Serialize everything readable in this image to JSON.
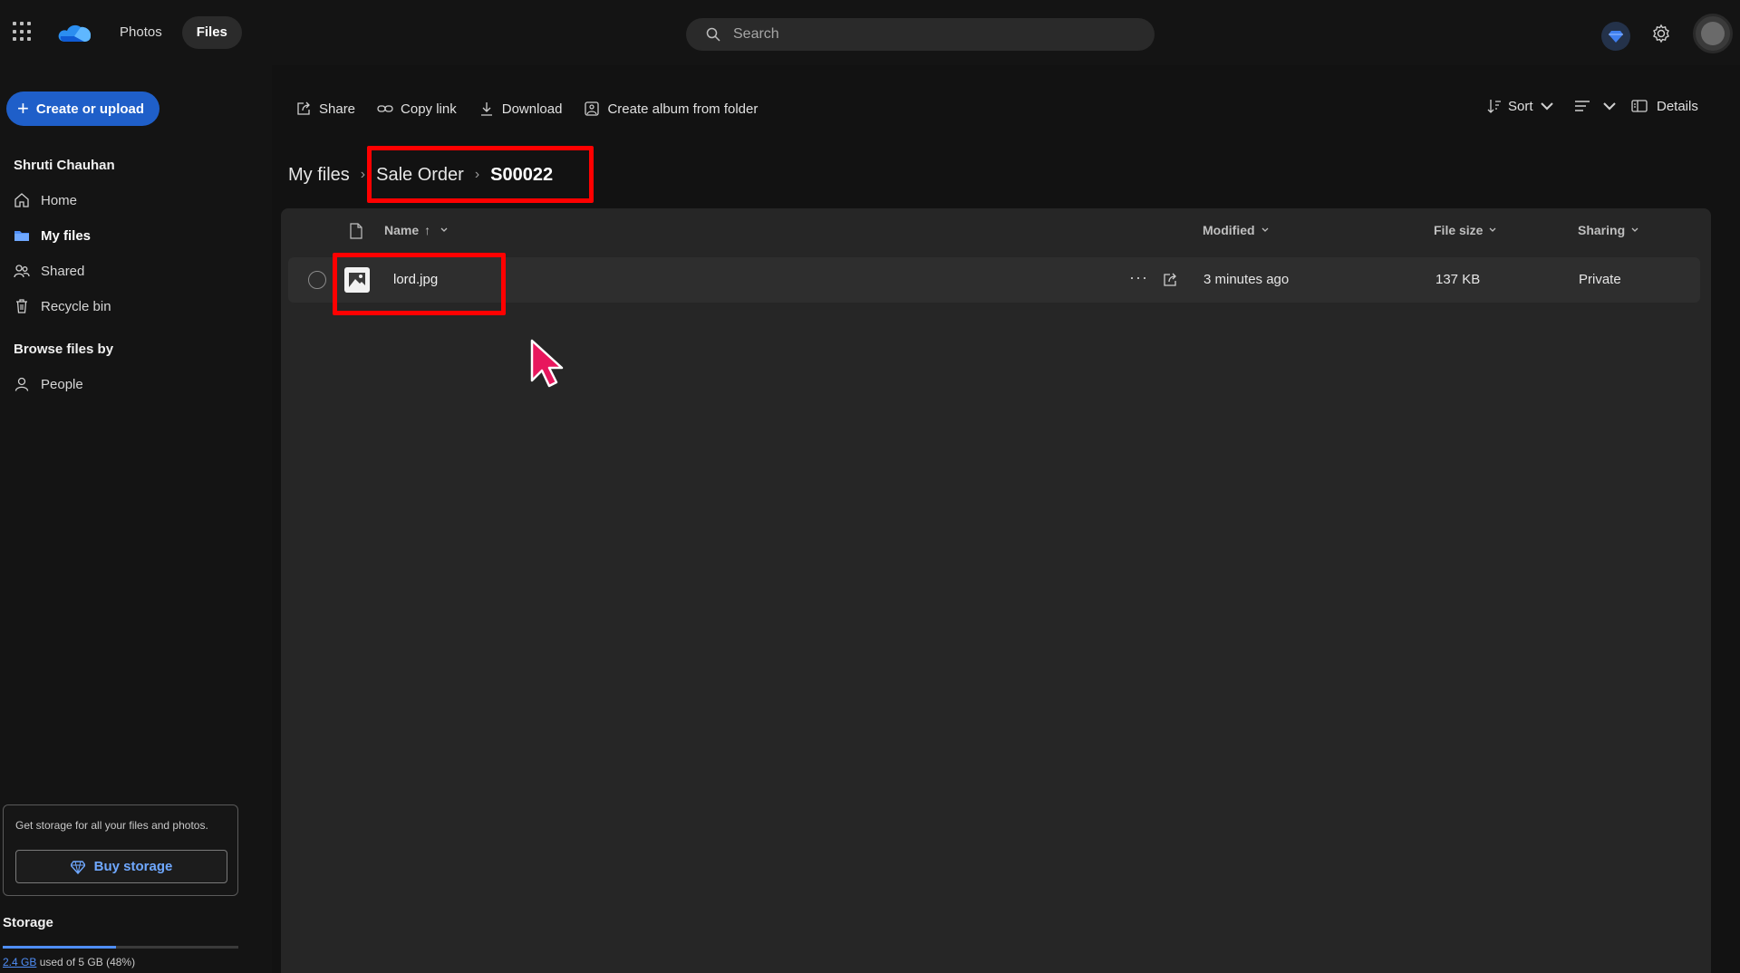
{
  "header": {
    "pivots": [
      {
        "label": "Photos",
        "active": false
      },
      {
        "label": "Files",
        "active": true
      }
    ],
    "search": {
      "placeholder": "Search"
    },
    "icons": [
      "app-launcher-icon",
      "onedrive-logo-icon",
      "premium-diamond-icon",
      "gear-icon",
      "avatar"
    ]
  },
  "sidebar": {
    "create_label": "Create or upload",
    "user_name": "Shruti Chauhan",
    "items": [
      {
        "label": "Home",
        "icon": "home-icon"
      },
      {
        "label": "My files",
        "icon": "folder-icon",
        "active": true
      },
      {
        "label": "Shared",
        "icon": "people-icon"
      },
      {
        "label": "Recycle bin",
        "icon": "trash-icon"
      }
    ],
    "browse_heading": "Browse files by",
    "browse_items": [
      {
        "label": "People",
        "icon": "person-icon"
      }
    ],
    "storage_card": {
      "text": "Get storage for all your files and photos.",
      "button": "Buy storage"
    },
    "storage": {
      "title": "Storage",
      "used_amount": "2.4 GB",
      "used_suffix": " used of 5 GB (48%)",
      "percent": 48
    }
  },
  "commands": {
    "share": "Share",
    "copy_link": "Copy link",
    "download": "Download",
    "create_album": "Create album from folder",
    "sort": "Sort",
    "details": "Details"
  },
  "breadcrumb": [
    "My files",
    "Sale Order",
    "S00022"
  ],
  "table": {
    "columns": {
      "name": "Name",
      "modified": "Modified",
      "size": "File size",
      "sharing": "Sharing"
    },
    "rows": [
      {
        "name": "lord.jpg",
        "modified": "3 minutes ago",
        "size": "137 KB",
        "sharing": "Private"
      }
    ]
  },
  "colors": {
    "accent": "#1f5fc9",
    "link": "#4f8ef7",
    "highlight": "#ff0000",
    "cursor": "#e8175d"
  }
}
